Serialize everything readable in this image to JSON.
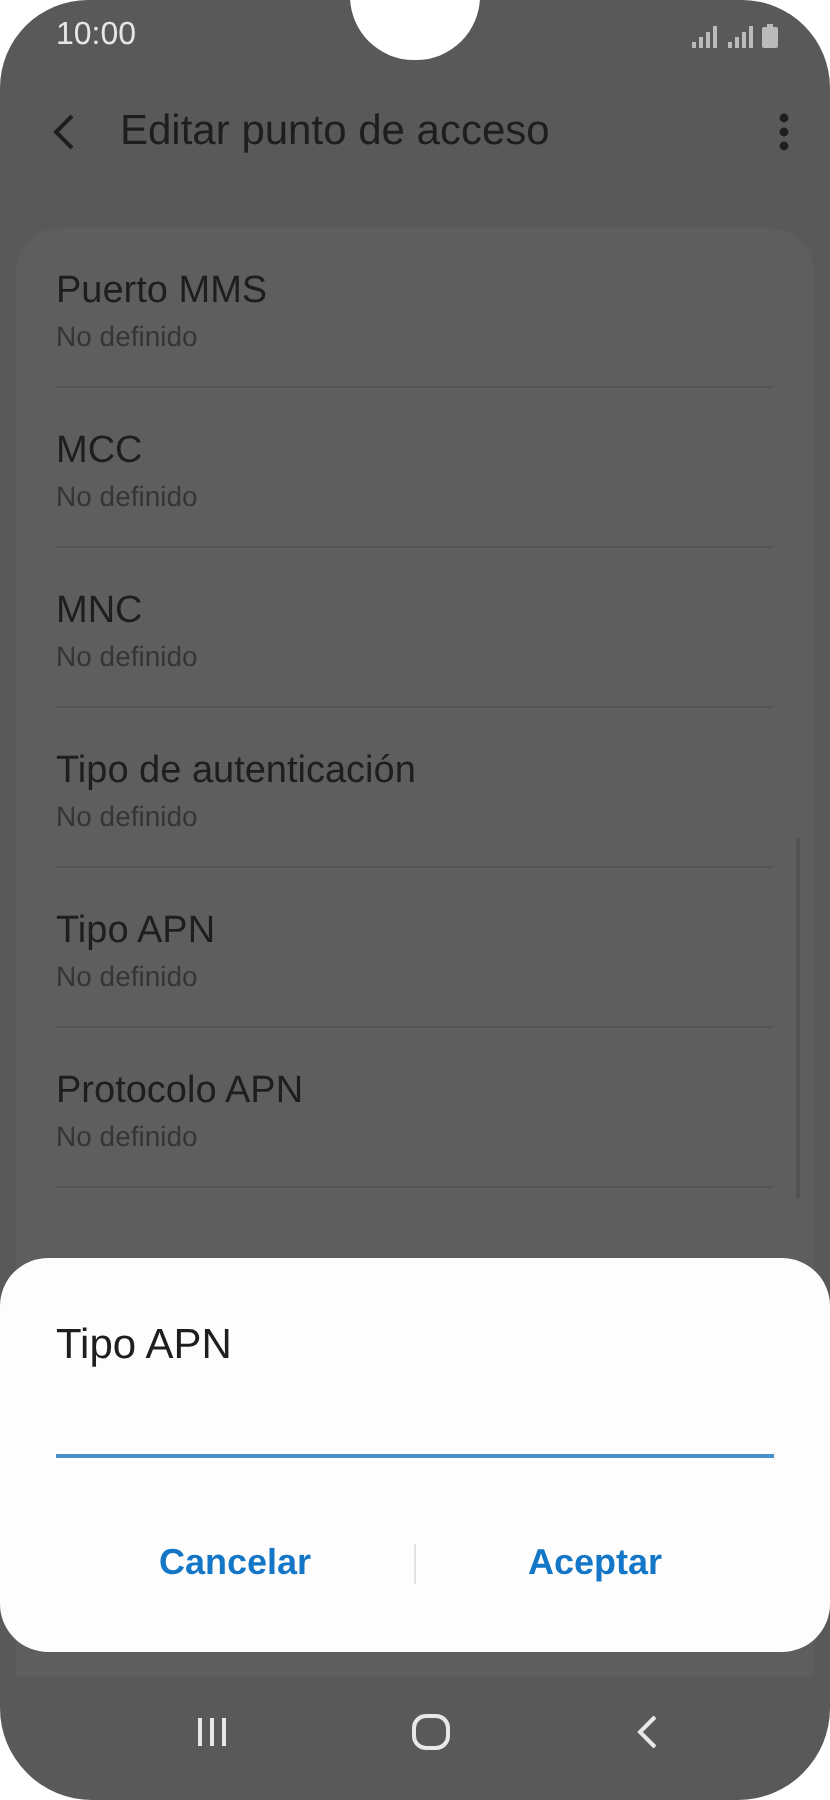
{
  "status_bar": {
    "time": "10:00"
  },
  "header": {
    "title": "Editar punto de acceso"
  },
  "settings": [
    {
      "title": "Puerto MMS",
      "value": "No definido"
    },
    {
      "title": "MCC",
      "value": "No definido"
    },
    {
      "title": "MNC",
      "value": "No definido"
    },
    {
      "title": "Tipo de autenticación",
      "value": "No definido"
    },
    {
      "title": "Tipo APN",
      "value": "No definido"
    },
    {
      "title": "Protocolo APN",
      "value": "No definido"
    }
  ],
  "dialog": {
    "title": "Tipo APN",
    "buttons": [
      "Cancelar",
      "Aceptar"
    ]
  }
}
